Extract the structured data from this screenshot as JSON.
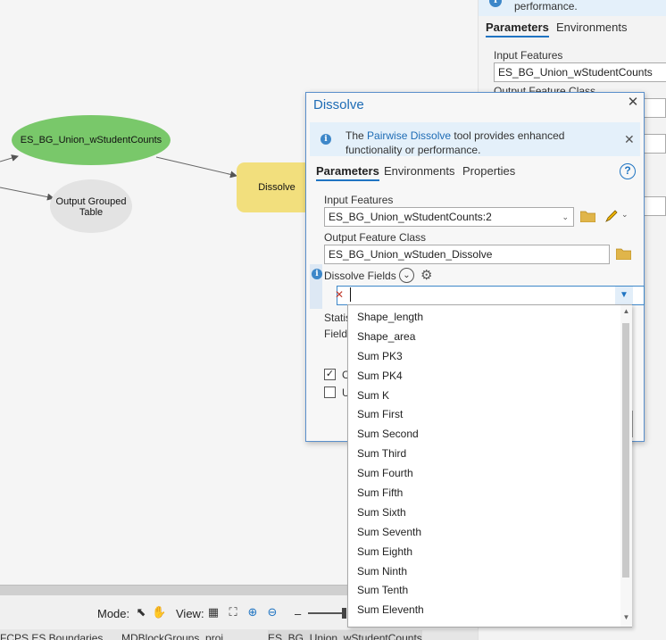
{
  "canvas": {
    "nodes": {
      "input_dataset": "ES_BG_Union_wStudentCounts",
      "output_table": "Output Grouped Table",
      "tool": "Dissolve"
    }
  },
  "right_panel": {
    "banner_text": "performance.",
    "tabs": [
      "Parameters",
      "Environments"
    ],
    "input_features_label": "Input Features",
    "input_features_value": "ES_BG_Union_wStudentCounts",
    "output_label_partial": "Output Feature Class"
  },
  "status_bar": {
    "mode_label": "Mode:",
    "view_label": "View:",
    "zoom_minus": "–"
  },
  "doc_tabs": [
    "FCPS ES Boundaries",
    "MDBlockGroups_proj",
    "ES_BG_Union_wStudentCounts"
  ],
  "dialog": {
    "title": "Dissolve",
    "banner": {
      "prefix": "The ",
      "link": "Pairwise Dissolve",
      "suffix": " tool provides enhanced functionality or performance."
    },
    "tabs": {
      "parameters": "Parameters",
      "environments": "Environments",
      "properties": "Properties"
    },
    "help": "?",
    "input_features_label": "Input Features",
    "input_features_value": "ES_BG_Union_wStudentCounts:2",
    "output_class_label": "Output Feature Class",
    "output_class_value": "ES_BG_Union_wStuden_Dissolve",
    "dissolve_fields_label": "Dissolve Fields",
    "dissolve_fields_value": "",
    "statistics_label": "Statis",
    "field_label": "Field",
    "check1_label": "C",
    "check2_label": "U"
  },
  "dropdown": {
    "options": [
      "Shape_length",
      "Shape_area",
      "Sum PK3",
      "Sum PK4",
      "Sum K",
      "Sum First",
      "Sum Second",
      "Sum Third",
      "Sum Fourth",
      "Sum Fifth",
      "Sum Sixth",
      "Sum Seventh",
      "Sum Eighth",
      "Sum Ninth",
      "Sum Tenth",
      "Sum Eleventh"
    ]
  },
  "colors": {
    "accent": "#1f74c2",
    "dataset_node": "#79c86a",
    "output_node": "#e3e3e3",
    "tool_node": "#f2df7d",
    "info_banner": "#e4f0fa"
  }
}
